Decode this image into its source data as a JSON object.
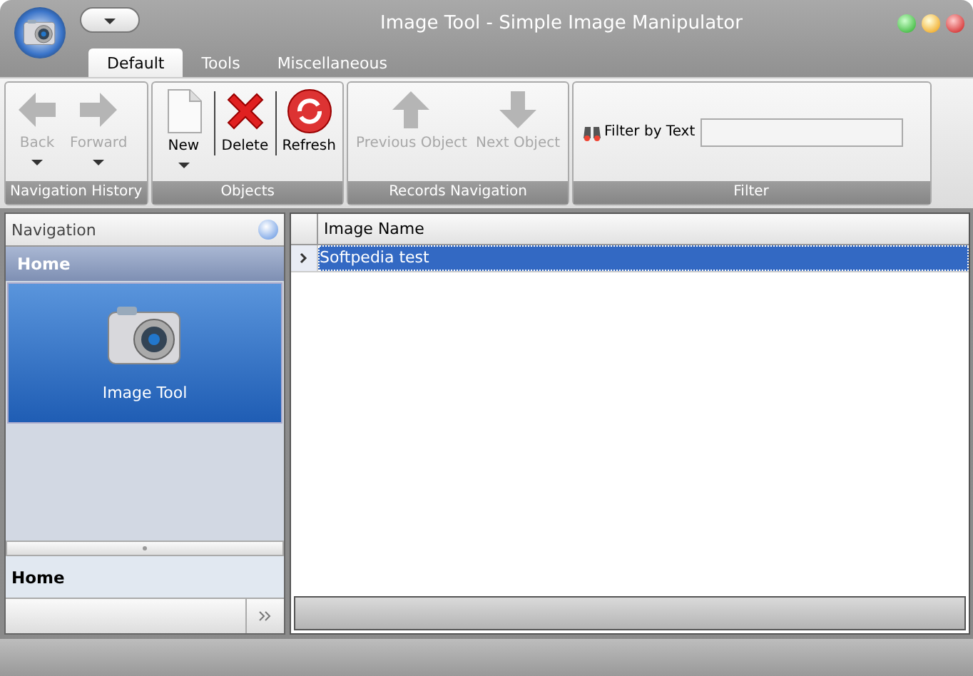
{
  "window": {
    "title": "Image Tool - Simple Image Manipulator"
  },
  "tabs": [
    {
      "label": "Default",
      "selected": true
    },
    {
      "label": "Tools",
      "selected": false
    },
    {
      "label": "Miscellaneous",
      "selected": false
    }
  ],
  "ribbon": {
    "groups": [
      {
        "label": "Navigation History",
        "buttons": [
          {
            "kind": "back",
            "label": "Back",
            "disabled": true,
            "dropdown": true
          },
          {
            "kind": "forward",
            "label": "Forward",
            "disabled": true,
            "dropdown": true
          }
        ]
      },
      {
        "label": "Objects",
        "buttons": [
          {
            "kind": "new",
            "label": "New",
            "disabled": false,
            "dropdown": true
          },
          {
            "kind": "delete",
            "label": "Delete",
            "disabled": false,
            "dropdown": false
          },
          {
            "kind": "refresh",
            "label": "Refresh",
            "disabled": false,
            "dropdown": false
          }
        ]
      },
      {
        "label": "Records Navigation",
        "buttons": [
          {
            "kind": "previous",
            "label": "Previous Object",
            "disabled": true,
            "dropdown": false
          },
          {
            "kind": "next",
            "label": "Next Object",
            "disabled": true,
            "dropdown": false
          }
        ]
      }
    ],
    "filter": {
      "group_label": "Filter",
      "label": "Filter by Text"
    }
  },
  "navigation": {
    "header": "Navigation",
    "group": "Home",
    "items": [
      {
        "label": "Image Tool",
        "selected": true
      }
    ],
    "footer_group": "Home"
  },
  "grid": {
    "columns": [
      "Image Name"
    ],
    "rows": [
      {
        "cells": [
          "Softpedia test"
        ],
        "selected": true
      }
    ]
  }
}
